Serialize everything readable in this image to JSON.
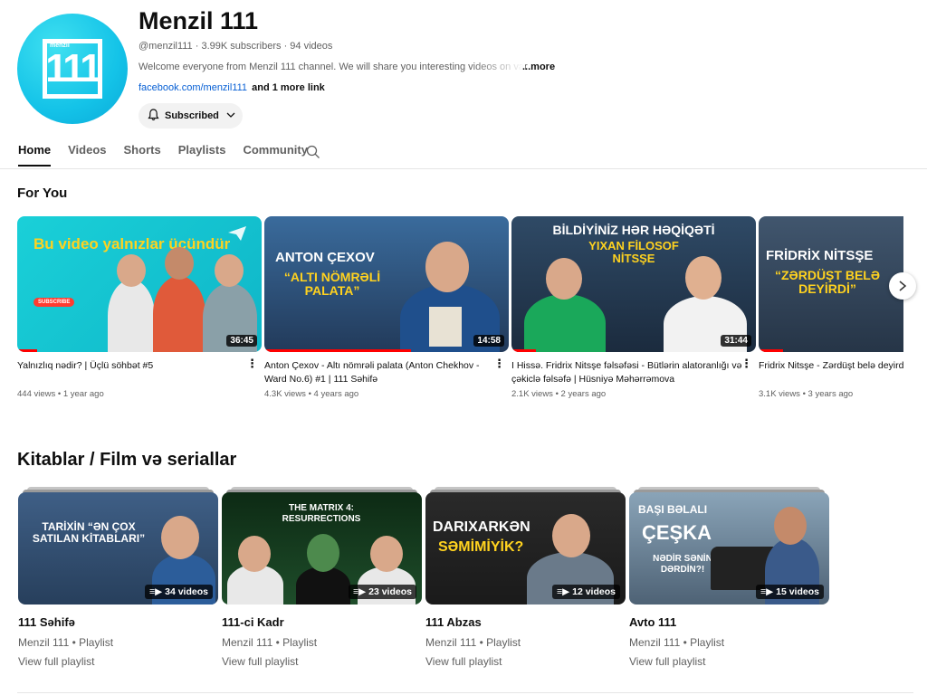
{
  "channel": {
    "name": "Menzil 111",
    "handle": "@menzil111",
    "subscribers": "3.99K subscribers",
    "videos_count": "94 videos",
    "description": "Welcome everyone from Menzil 111 channel. We will share you interesting videos on vari",
    "more": "...more",
    "link": "facebook.com/menzil111",
    "more_links": "and 1 more link",
    "subscribe_label": "Subscribed",
    "avatar_text": "111",
    "avatar_small": "menzil"
  },
  "tabs": [
    "Home",
    "Videos",
    "Shorts",
    "Playlists",
    "Community"
  ],
  "sections": {
    "for_you": "For You",
    "playlists": "Kitablar / Film və seriallar"
  },
  "videos": [
    {
      "title": "Yalnızlıq nədir? | Üçlü söhbət #5",
      "meta": "444 views • 1 year ago",
      "duration": "36:45",
      "progress": 0.08,
      "thumb_text": "Bu video yalnızlar üçündür",
      "thumb_sub": "SUBSCRIBE"
    },
    {
      "title": "Anton Çexov - Altı nömrəli palata (Anton Chekhov - Ward No.6) #1 | 111 Səhifə",
      "meta": "4.3K views • 4 years ago",
      "duration": "14:58",
      "progress": 0.6,
      "thumb_text": "ANTON ÇEXOV",
      "thumb_text2": "“ALTI NÖMRƏLİ PALATA”"
    },
    {
      "title": "I Hissə. Fridrix Nitsşe fəlsəfəsi - Bütlərin alatoranlığı və çəkiclə fəlsəfə | Hüsniyə Məhərrəmova",
      "meta": "2.1K views • 2 years ago",
      "duration": "31:44",
      "progress": 0.1,
      "thumb_text": "BİLDİYİNİZ HƏR HƏQİQƏTİ",
      "thumb_text2": "YIXAN FİLOSOF NİTSŞE"
    },
    {
      "title": "Fridrix Nitsşe - Zərdüşt belə deyirdi - Nietzsche -Thus spoke Zarathustra",
      "meta": "3.1K views • 3 years ago",
      "duration": "",
      "progress": 0.1,
      "thumb_text": "FRİDRİX NİTSŞE",
      "thumb_text2": "“ZƏRDÜŞT BELƏ DEYİRDİ”"
    }
  ],
  "playlists": [
    {
      "title": "111 Səhifə",
      "meta": "Menzil 111 • Playlist",
      "link": "View full playlist",
      "count": "34 videos",
      "thumb_text": "TARİXİN “ƏN ÇOX SATILAN KİTABLARI”"
    },
    {
      "title": "111-ci Kadr",
      "meta": "Menzil 111 • Playlist",
      "link": "View full playlist",
      "count": "23 videos",
      "thumb_text": "THE MATRIX 4: RESURRECTIONS"
    },
    {
      "title": "111 Abzas",
      "meta": "Menzil 111 • Playlist",
      "link": "View full playlist",
      "count": "12 videos",
      "thumb_text": "DARIXARKƏN",
      "thumb_text2": "SƏMİMİYİK?"
    },
    {
      "title": "Avto 111",
      "meta": "Menzil 111 • Playlist",
      "link": "View full playlist",
      "count": "15 videos",
      "thumb_text": "BAŞI BƏLALI",
      "thumb_text2": "ÇEŞKA",
      "thumb_text3": "NƏDİR SƏNİN DƏRDİN?!"
    }
  ],
  "colors": {
    "accent": "#065fd4",
    "progress": "#ff0000",
    "avatar": "#14c3e8",
    "yellow": "#ffd21f"
  },
  "icons": {
    "bell": "bell-icon",
    "search": "search-icon",
    "kebab": "more-vert-icon",
    "next": "chevron-right-icon",
    "playlist": "playlist-icon"
  }
}
